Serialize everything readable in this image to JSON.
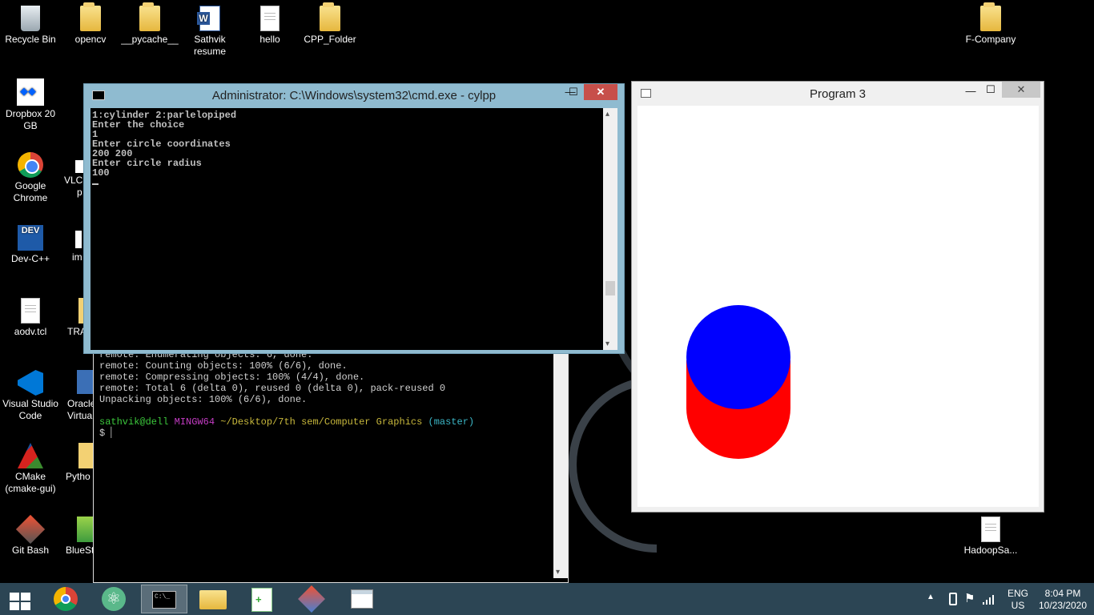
{
  "desktop": {
    "icons": [
      {
        "label": "Recycle Bin",
        "icon": "recycle-bin-icon"
      },
      {
        "label": "opencv",
        "icon": "folder-icon"
      },
      {
        "label": "__pycache__",
        "icon": "folder-icon"
      },
      {
        "label": "Sathvik resume",
        "icon": "word-document-icon"
      },
      {
        "label": "hello",
        "icon": "text-file-icon"
      },
      {
        "label": "CPP_Folder",
        "icon": "folder-icon"
      },
      {
        "label": "F-Company",
        "icon": "folder-icon"
      },
      {
        "label": "Dropbox 20 GB",
        "icon": "dropbox-icon"
      },
      {
        "label": "Google Chrome",
        "icon": "chrome-icon"
      },
      {
        "label": "Dev-C++",
        "icon": "devcpp-icon"
      },
      {
        "label": "aodv.tcl",
        "icon": "text-file-icon"
      },
      {
        "label": "Visual Studio Code",
        "icon": "vscode-icon"
      },
      {
        "label": "CMake (cmake-gui)",
        "icon": "cmake-icon"
      },
      {
        "label": "Git Bash",
        "icon": "git-bash-icon"
      },
      {
        "label": "HadoopSa...",
        "icon": "text-file-icon"
      },
      {
        "label": "VLC",
        "icon": "vlc-icon"
      },
      {
        "label": "p",
        "icon": "vlc-icon"
      },
      {
        "label": "im",
        "icon": "file-icon"
      },
      {
        "label": "TRA",
        "icon": "folder-icon"
      },
      {
        "label": "Oracle",
        "icon": "virtualbox-icon"
      },
      {
        "label": "Virtua",
        "icon": "virtualbox-icon"
      },
      {
        "label": "Pytho",
        "icon": "python-icon"
      },
      {
        "label": "BlueSt",
        "icon": "bluestacks-icon"
      }
    ]
  },
  "cmd_window": {
    "title": "Administrator: C:\\Windows\\system32\\cmd.exe - cylpp",
    "console_lines": [
      "1:cylinder 2:parlelopiped",
      "Enter the choice",
      "1",
      "Enter circle coordinates",
      "200 200",
      "Enter circle radius",
      "100"
    ],
    "min_label": "—",
    "max_label": "☐",
    "close_label": "✕"
  },
  "git_bash": {
    "lines": [
      "remote: Enumerating objects: 6, done.",
      "remote: Counting objects: 100% (6/6), done.",
      "remote: Compressing objects: 100% (4/4), done.",
      "remote: Total 6 (delta 0), reused 0 (delta 0), pack-reused 0",
      "Unpacking objects: 100% (6/6), done."
    ],
    "prompt_user": "sathvik@dell",
    "prompt_env": "MINGW64",
    "prompt_path": "~/Desktop/7th sem/Computer Graphics",
    "prompt_branch": "(master)",
    "prompt_symbol": "$"
  },
  "program3_window": {
    "title": "Program 3",
    "min_label": "—",
    "max_label": "☐",
    "close_label": "✕",
    "shape_colors": {
      "top": "#0000ff",
      "body": "#ff0000",
      "background": "#ffffff"
    }
  },
  "taskbar": {
    "apps": [
      {
        "name": "start-button",
        "icon": "windows-logo-icon"
      },
      {
        "name": "chrome",
        "icon": "chrome-icon"
      },
      {
        "name": "atom",
        "icon": "atom-icon"
      },
      {
        "name": "cmd",
        "icon": "cmd-icon"
      },
      {
        "name": "file-explorer",
        "icon": "folder-icon"
      },
      {
        "name": "notepad-plus",
        "icon": "notepad-plus-icon"
      },
      {
        "name": "git-gui",
        "icon": "git-icon"
      },
      {
        "name": "program3",
        "icon": "window-icon"
      }
    ],
    "lang_top": "ENG",
    "lang_bottom": "US",
    "time": "8:04 PM",
    "date": "10/23/2020",
    "accent": "#2c4554"
  }
}
